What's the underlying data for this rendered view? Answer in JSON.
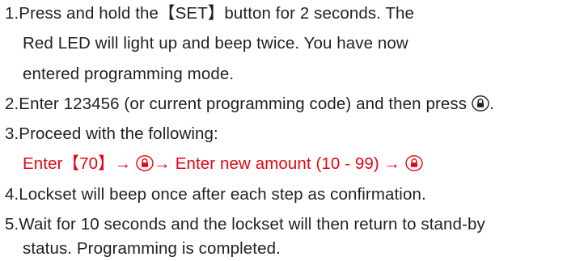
{
  "steps": {
    "s1": {
      "line1": "1.Press and hold the【SET】button for 2 seconds.  The",
      "line2": "Red LED will light up and beep twice.  You have now",
      "line3": "entered programming mode."
    },
    "s2": {
      "text": "2.Enter 123456 (or current programming code) and then press",
      "end": "."
    },
    "s3": {
      "text": "3.Proceed with the following:",
      "seq": {
        "part1": "Enter【70】→",
        "part2": "→  Enter new amount (10 - 99)  →"
      }
    },
    "s4": {
      "text": "4.Lockset will beep once after each step as confirmation."
    },
    "s5": {
      "line1": "5.Wait for 10 seconds and the lockset will then return to stand-by",
      "line2": "status.  Programming is completed."
    }
  },
  "icons": {
    "lock_key": "lock-button-icon"
  },
  "colors": {
    "text": "#231f20",
    "highlight": "#e30613"
  }
}
